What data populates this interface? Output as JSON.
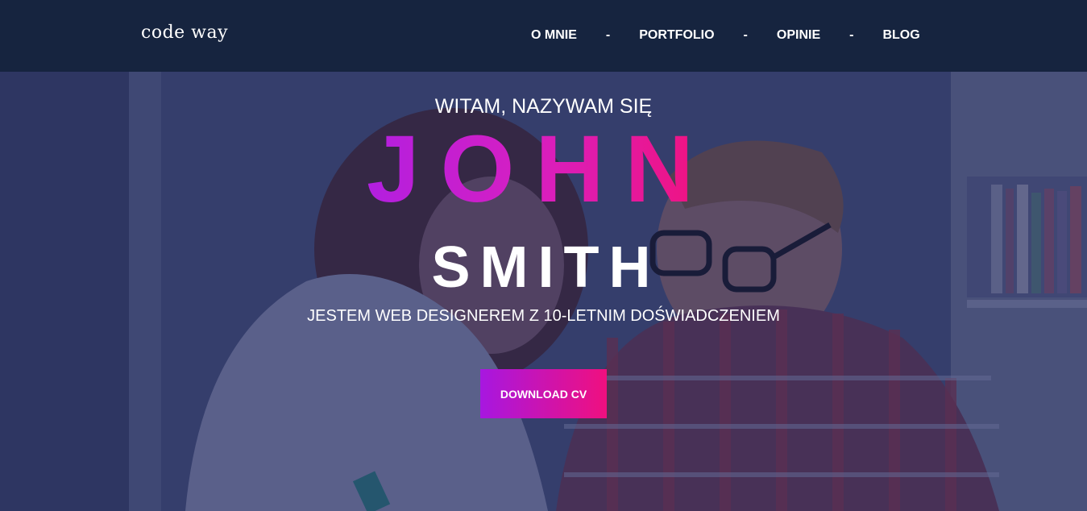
{
  "header": {
    "logo": "code way",
    "nav": [
      {
        "label": "O MNIE"
      },
      {
        "label": "PORTFOLIO"
      },
      {
        "label": "OPINIE"
      },
      {
        "label": "BLOG"
      }
    ],
    "separator": "-"
  },
  "hero": {
    "greeting": "WITAM, NAZYWAM SIĘ",
    "first_name": "JOHN",
    "last_name": "SMITH",
    "tagline": "JESTEM WEB DESIGNEREM Z 10-LETNIM DOŚWIADCZENIEM",
    "cta_label": "DOWNLOAD CV",
    "background_image": "photo-two-people-working-icon"
  },
  "colors": {
    "header_bg": "#16243f",
    "accent_start": "#a717e0",
    "accent_end": "#f0107f",
    "text": "#ffffff"
  }
}
